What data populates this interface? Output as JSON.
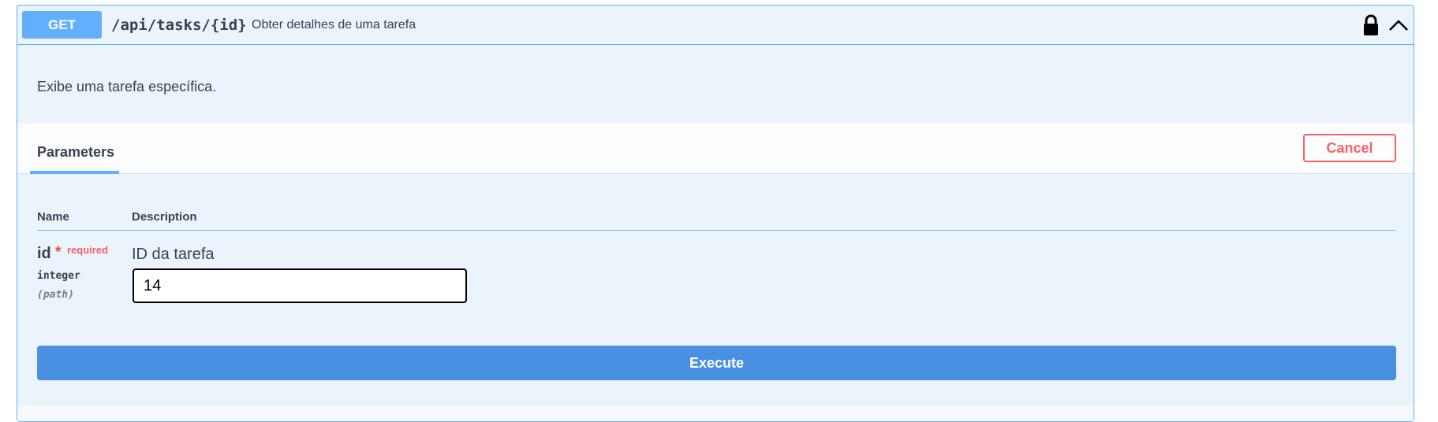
{
  "operation": {
    "method": "GET",
    "path": "/api/tasks/{id}",
    "summary": "Obter detalhes de uma tarefa",
    "description": "Exibe uma tarefa específica."
  },
  "icons": {
    "lock": "lock-icon",
    "collapse": "chevron-up-icon"
  },
  "parameters_section": {
    "tab_label": "Parameters",
    "cancel_label": "Cancel",
    "columns": {
      "name": "Name",
      "description": "Description"
    },
    "params": [
      {
        "name": "id",
        "required_marker": "*",
        "required_label": "required",
        "type": "integer",
        "in": "(path)",
        "description": "ID da tarefa",
        "value": "14"
      }
    ]
  },
  "execute_label": "Execute",
  "colors": {
    "get_accent": "#61affe",
    "execute": "#4990e2",
    "cancel": "#ff6060",
    "background": "#ebf3fb"
  }
}
